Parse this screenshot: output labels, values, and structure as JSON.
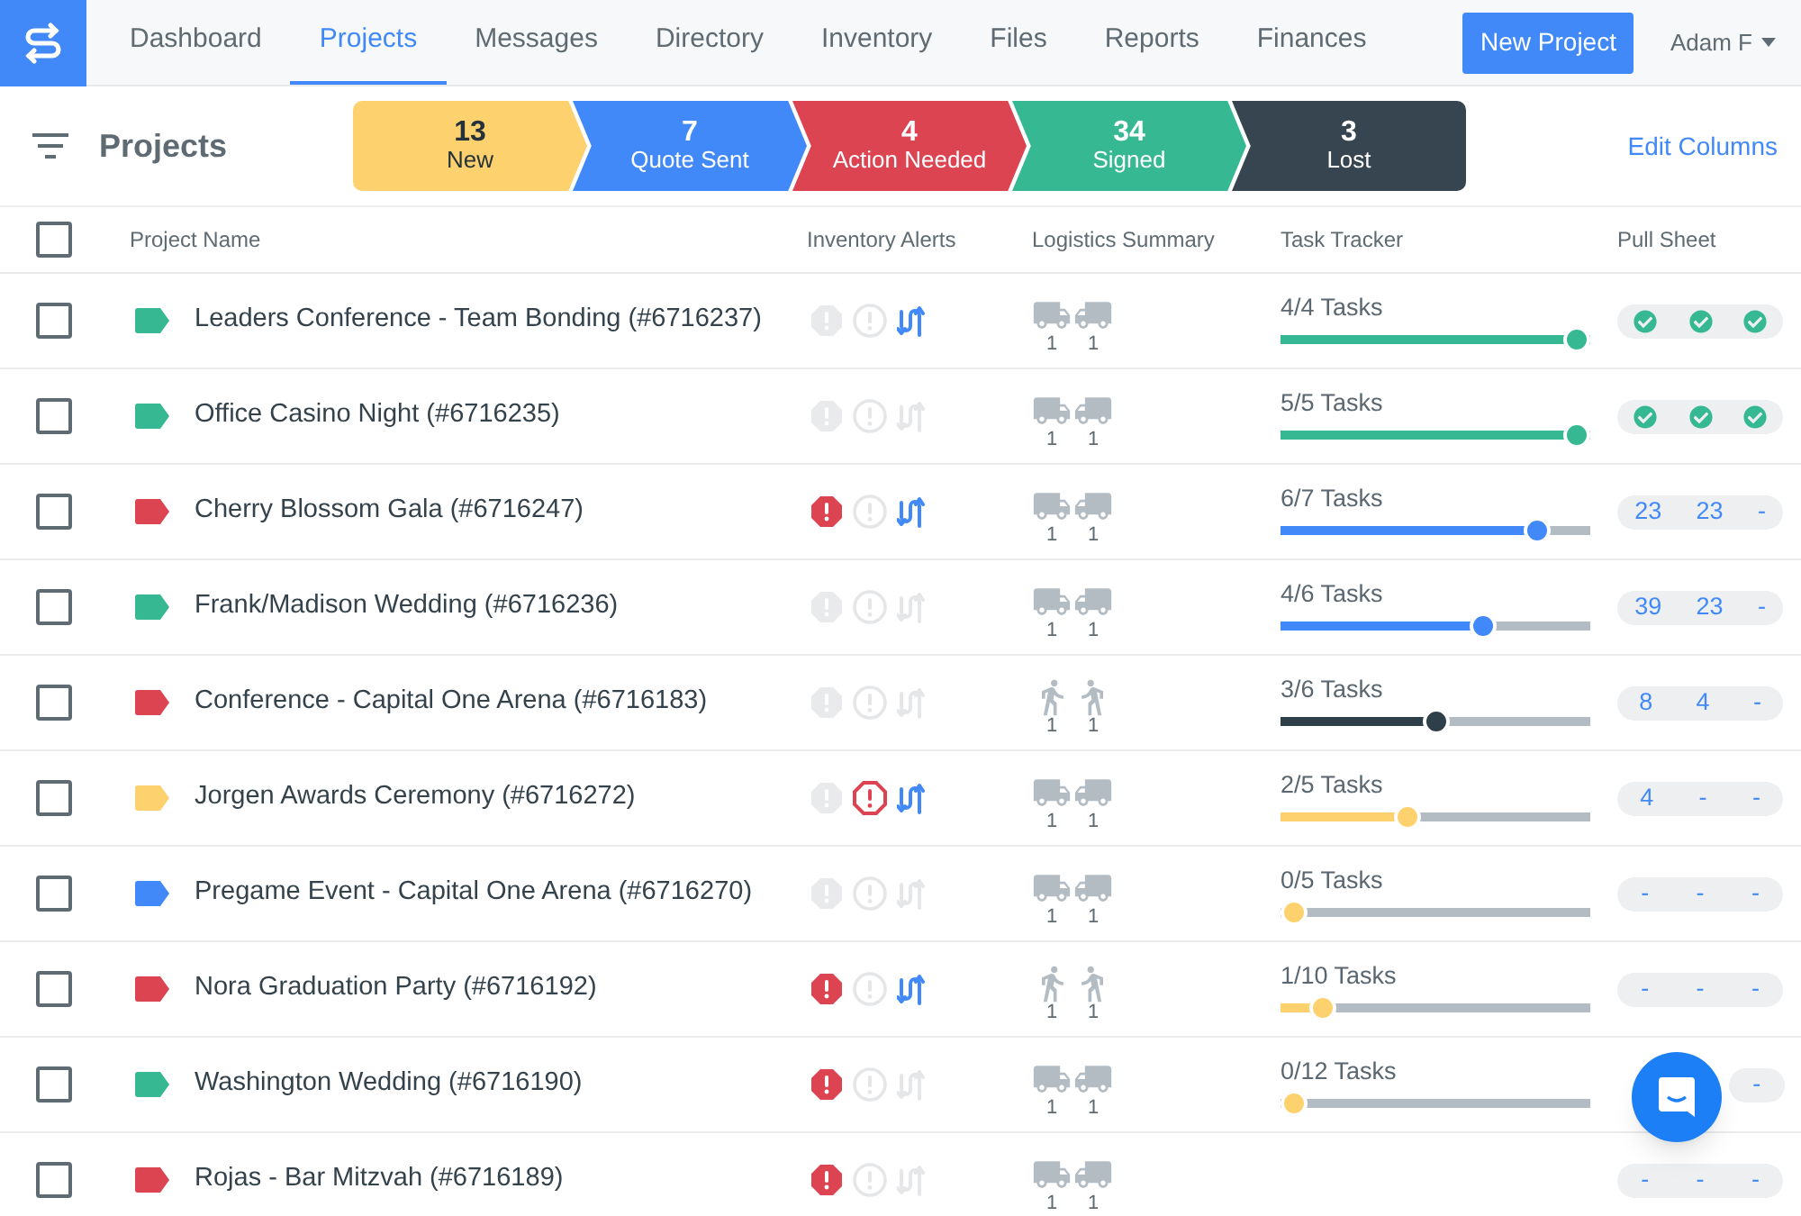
{
  "nav": {
    "tabs": [
      {
        "label": "Dashboard",
        "selected": false
      },
      {
        "label": "Projects",
        "selected": true
      },
      {
        "label": "Messages",
        "selected": false
      },
      {
        "label": "Directory",
        "selected": false
      },
      {
        "label": "Inventory",
        "selected": false
      },
      {
        "label": "Files",
        "selected": false
      },
      {
        "label": "Reports",
        "selected": false
      },
      {
        "label": "Finances",
        "selected": false
      }
    ],
    "new_button": "New Project",
    "user": "Adam F"
  },
  "toolbar": {
    "title": "Projects",
    "edit_link": "Edit Columns"
  },
  "pipeline": [
    {
      "count": "13",
      "label": "New",
      "color": "#fdd26e"
    },
    {
      "count": "7",
      "label": "Quote Sent",
      "color": "#4189f8"
    },
    {
      "count": "4",
      "label": "Action Needed",
      "color": "#dc4452"
    },
    {
      "count": "34",
      "label": "Signed",
      "color": "#36b992"
    },
    {
      "count": "3",
      "label": "Lost",
      "color": "#36454f"
    }
  ],
  "table": {
    "select_all_checked": false,
    "columns": [
      "Project Name",
      "Inventory Alerts",
      "Logistics Summary",
      "Task Tracker",
      "Pull Sheet"
    ],
    "rows": [
      {
        "checked": false,
        "color": "#36b992",
        "name": "Leaders Conference - Team Bonding (#6716237)",
        "alerts": {
          "shortage": false,
          "warning": false,
          "transfer": true
        },
        "logistics": {
          "kind": "truck",
          "counts": [
            "1",
            "1"
          ]
        },
        "tasks": {
          "text": "4/4 Tasks",
          "level": 1,
          "color": "#36b992"
        },
        "pull_sheet": [
          {
            "kind": "check"
          },
          {
            "kind": "check"
          },
          {
            "kind": "check"
          }
        ]
      },
      {
        "checked": false,
        "color": "#36b992",
        "name": "Office Casino Night (#6716235)",
        "alerts": {
          "shortage": false,
          "warning": false,
          "transfer": false
        },
        "logistics": {
          "kind": "truck",
          "counts": [
            "1",
            "1"
          ]
        },
        "tasks": {
          "text": "5/5 Tasks",
          "level": 1,
          "color": "#36b992"
        },
        "pull_sheet": [
          {
            "kind": "check"
          },
          {
            "kind": "check"
          },
          {
            "kind": "check"
          }
        ]
      },
      {
        "checked": false,
        "color": "#dc4452",
        "name": "Cherry Blossom Gala (#6716247)",
        "alerts": {
          "shortage": true,
          "warning": false,
          "transfer": true
        },
        "logistics": {
          "kind": "truck",
          "counts": [
            "1",
            "1"
          ]
        },
        "tasks": {
          "text": "6/7 Tasks",
          "level": 0.857,
          "color": "#4189f8"
        },
        "pull_sheet": [
          {
            "kind": "text",
            "text": "23"
          },
          {
            "kind": "text",
            "text": "23"
          },
          {
            "kind": "text",
            "text": "-"
          }
        ]
      },
      {
        "checked": false,
        "color": "#36b992",
        "name": "Frank/Madison Wedding (#6716236)",
        "alerts": {
          "shortage": false,
          "warning": false,
          "transfer": false
        },
        "logistics": {
          "kind": "truck",
          "counts": [
            "1",
            "1"
          ]
        },
        "tasks": {
          "text": "4/6 Tasks",
          "level": 0.667,
          "color": "#4189f8"
        },
        "pull_sheet": [
          {
            "kind": "text",
            "text": "39"
          },
          {
            "kind": "text",
            "text": "23"
          },
          {
            "kind": "text",
            "text": "-"
          }
        ]
      },
      {
        "checked": false,
        "color": "#dc4452",
        "name": "Conference - Capital One Arena (#6716183)",
        "alerts": {
          "shortage": false,
          "warning": false,
          "transfer": false
        },
        "logistics": {
          "kind": "walk",
          "counts": [
            "1",
            "1"
          ]
        },
        "tasks": {
          "text": "3/6 Tasks",
          "level": 0.5,
          "color": "#2e3f4a"
        },
        "pull_sheet": [
          {
            "kind": "text",
            "text": "8"
          },
          {
            "kind": "text",
            "text": "4"
          },
          {
            "kind": "text",
            "text": "-"
          }
        ]
      },
      {
        "checked": false,
        "color": "#fdd26e",
        "name": "Jorgen Awards Ceremony (#6716272)",
        "alerts": {
          "shortage": false,
          "warning": true,
          "transfer": true
        },
        "logistics": {
          "kind": "truck",
          "counts": [
            "1",
            "1"
          ]
        },
        "tasks": {
          "text": "2/5 Tasks",
          "level": 0.4,
          "color": "#fdd26e"
        },
        "pull_sheet": [
          {
            "kind": "text",
            "text": "4"
          },
          {
            "kind": "text",
            "text": "-"
          },
          {
            "kind": "text",
            "text": "-"
          }
        ]
      },
      {
        "checked": false,
        "color": "#4189f8",
        "name": "Pregame Event - Capital One Arena (#6716270)",
        "alerts": {
          "shortage": false,
          "warning": false,
          "transfer": false
        },
        "logistics": {
          "kind": "truck",
          "counts": [
            "1",
            "1"
          ]
        },
        "tasks": {
          "text": "0/5 Tasks",
          "level": 0,
          "color": "#fdd26e"
        },
        "pull_sheet": [
          {
            "kind": "text",
            "text": "-"
          },
          {
            "kind": "text",
            "text": "-"
          },
          {
            "kind": "text",
            "text": "-"
          }
        ]
      },
      {
        "checked": false,
        "color": "#dc4452",
        "name": "Nora Graduation Party (#6716192)",
        "alerts": {
          "shortage": true,
          "warning": false,
          "transfer": true
        },
        "logistics": {
          "kind": "walk",
          "counts": [
            "1",
            "1"
          ]
        },
        "tasks": {
          "text": "1/10 Tasks",
          "level": 0.1,
          "color": "#fdd26e"
        },
        "pull_sheet": [
          {
            "kind": "text",
            "text": "-"
          },
          {
            "kind": "text",
            "text": "-"
          },
          {
            "kind": "text",
            "text": "-"
          }
        ]
      },
      {
        "checked": false,
        "color": "#36b992",
        "name": "Washington Wedding (#6716190)",
        "alerts": {
          "shortage": true,
          "warning": false,
          "transfer": false
        },
        "logistics": {
          "kind": "truck",
          "counts": [
            "1",
            "1"
          ]
        },
        "tasks": {
          "text": "0/12 Tasks",
          "level": 0,
          "color": "#fdd26e"
        },
        "pull_sheet": [
          {
            "kind": "hidden"
          },
          {
            "kind": "hidden"
          },
          {
            "kind": "text",
            "text": "-"
          }
        ]
      },
      {
        "checked": false,
        "color": "#dc4452",
        "name": "Rojas - Bar Mitzvah (#6716189)",
        "alerts": {
          "shortage": true,
          "warning": false,
          "transfer": false
        },
        "logistics": {
          "kind": "truck",
          "counts": [
            "1",
            "1"
          ]
        },
        "pull_sheet": [
          {
            "kind": "text",
            "text": "-"
          },
          {
            "kind": "text",
            "text": "-"
          },
          {
            "kind": "text",
            "text": "-"
          }
        ]
      }
    ]
  }
}
